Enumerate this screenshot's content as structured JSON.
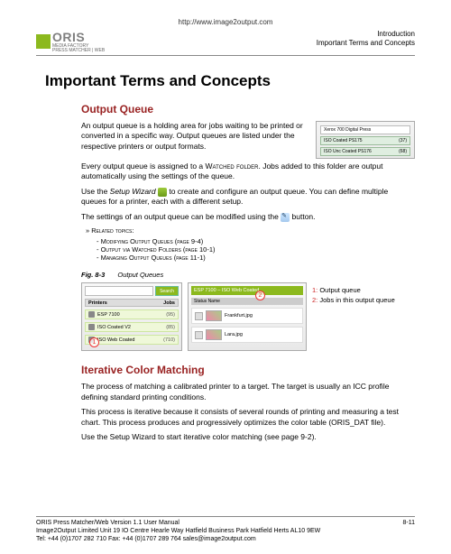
{
  "url": "http://www.image2output.com",
  "logo": {
    "brand": "ORIS",
    "sub1": "MEDIA FACTORY",
    "sub2": "PRESS MATCHER | WEB"
  },
  "headerRight": {
    "line1": "Introduction",
    "line2": "Important Terms and Concepts"
  },
  "h1": "Important Terms and Concepts",
  "section1": {
    "title": "Output Queue",
    "p1": "An output queue is a holding area for jobs waiting to be printed or converted in a specific way. Output queues are listed under the respective printers or output formats.",
    "p2a": "Every output queue is assigned to a ",
    "p2watched": "Watched folder",
    "p2b": ". Jobs added to this folder are output automatically using the settings of the queue.",
    "p3a": "Use the ",
    "p3setup": "Setup Wizard",
    "p3b": " to create and configure an output queue. You can define multiple queues for a printer, each with a different setup.",
    "p4a": "The settings of an output queue can be modified using the ",
    "p4b": " button.",
    "relatedTitle": "»   Related topics:",
    "related1": "- Modifying Output Queues (page 9-4)",
    "related2": "- Output via Watched Folders (page 10-1)",
    "related3": "- Managing Output Queues (page 11-1)"
  },
  "floatFig": {
    "row1a": "Xerox 700 Digital Press",
    "row1b": "",
    "row2a": "ISO Coated PS175",
    "row2b": "(37)",
    "row3a": "ISO Unc Coated PS176",
    "row3b": "(68)"
  },
  "figCaption": {
    "label": "Fig. 8-3",
    "text": "Output Queues"
  },
  "fig": {
    "searchBtn": "Search",
    "printersHead": "Printers",
    "jobsHead": "Jobs",
    "row1name": "ESP 7100",
    "row1cnt": "(95)",
    "row2name": "ISO Coated V2",
    "row2cnt": "(85)",
    "row3name": "ISO Web Coated",
    "row3cnt": "(710)",
    "rightHead": "ESP 7100 – ISO Web Coated",
    "rightSub1": "Status  Name",
    "rightFile1": "Frankfurt.jpg",
    "rightFile2": "Lara.jpg",
    "legend1n": "1:",
    "legend1": " Output queue",
    "legend2n": "2:",
    "legend2": " Jobs in this output queue"
  },
  "section2": {
    "title": "Iterative Color Matching",
    "p1": "The process of matching a calibrated printer to a target. The target is usually an ICC profile defining standard printing conditions.",
    "p2": "This process is iterative because it consists of several rounds of printing and measuring a test chart. This process produces and progressively optimizes the color table (ORIS_DAT file).",
    "p3": "Use the Setup Wizard to start iterative color matching (see page 9-2)."
  },
  "footer": {
    "left": "ORIS Press Matcher/Web Version 1.1   User Manual",
    "right": "8-11",
    "addr": "Image2Output Limited  Unit 19 IO Centre Hearle Way Hatfield Business Park Hatfield Herts AL10 9EW",
    "tel": "Tel: +44 (0)1707 282 710 Fax: +44 (0)1707 289 764 sales@image2output.com"
  }
}
